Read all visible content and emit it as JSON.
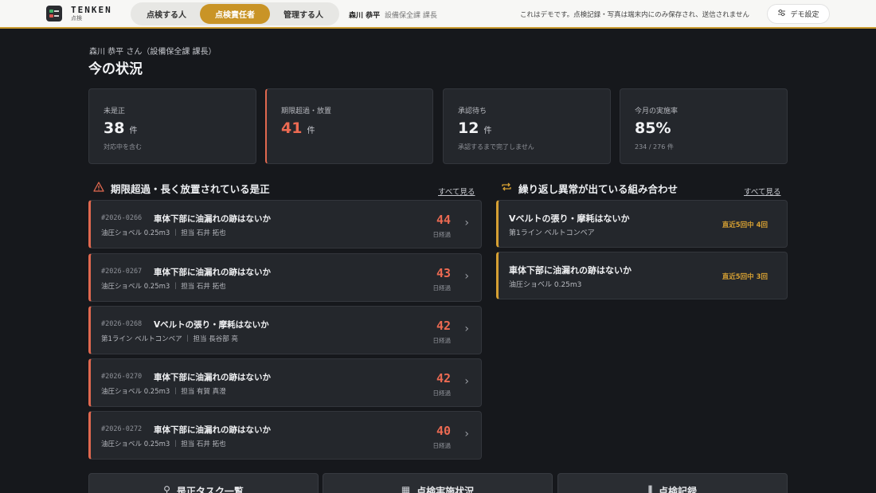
{
  "app": {
    "brand": "TENKEN",
    "brand_sub": "点検"
  },
  "roles": [
    "点検する人",
    "点検責任者",
    "管理する人"
  ],
  "user": {
    "name": "森川 恭平",
    "dept": "設備保全課 課長"
  },
  "demo_notice": "これはデモです。点検記録・写真は端末内にのみ保存され、送信されません",
  "demo_settings_label": "デモ設定",
  "greeting": "森川 恭平 さん（設備保全課 課長）",
  "page_title": "今の状況",
  "stats": [
    {
      "label": "未是正",
      "value": "38",
      "unit": "件",
      "note": "対応中を含む"
    },
    {
      "label": "期限超過・放置",
      "value": "41",
      "unit": "件",
      "note": ""
    },
    {
      "label": "承認待ち",
      "value": "12",
      "unit": "件",
      "note": "承認するまで完了しません"
    },
    {
      "label": "今月の実施率",
      "value": "85%",
      "unit": "",
      "note": "234 / 276 件"
    }
  ],
  "overdue": {
    "title": "期限超過・長く放置されている是正",
    "see_all": "すべて見る",
    "days_label": "日経過",
    "items": [
      {
        "id": "#2026-0266",
        "title": "車体下部に油漏れの跡はないか",
        "meta": "油圧ショベル 0.25m3 ｜ 担当 石井 拓也",
        "days": "44"
      },
      {
        "id": "#2026-0267",
        "title": "車体下部に油漏れの跡はないか",
        "meta": "油圧ショベル 0.25m3 ｜ 担当 石井 拓也",
        "days": "43"
      },
      {
        "id": "#2026-0268",
        "title": "Vベルトの張り・摩耗はないか",
        "meta": "第1ライン ベルトコンベア ｜ 担当 長谷部 亮",
        "days": "42"
      },
      {
        "id": "#2026-0270",
        "title": "車体下部に油漏れの跡はないか",
        "meta": "油圧ショベル 0.25m3 ｜ 担当 有賀 真澄",
        "days": "42"
      },
      {
        "id": "#2026-0272",
        "title": "車体下部に油漏れの跡はないか",
        "meta": "油圧ショベル 0.25m3 ｜ 担当 石井 拓也",
        "days": "40"
      }
    ]
  },
  "repeats": {
    "title": "繰り返し異常が出ている組み合わせ",
    "see_all": "すべて見る",
    "items": [
      {
        "title": "Vベルトの張り・摩耗はないか",
        "sub": "第1ライン ベルトコンベア",
        "count": "直近5回中 4回"
      },
      {
        "title": "車体下部に油漏れの跡はないか",
        "sub": "油圧ショベル 0.25m3",
        "count": "直近5回中 3回"
      }
    ]
  },
  "bottom_buttons": [
    "是正タスク一覧",
    "点検実施状況",
    "点検記録"
  ],
  "icons": {
    "alert": "warning-triangle-icon",
    "repeat": "repeat-arrows-icon",
    "settings": "sliders-icon",
    "chevron": "chevron-right-icon"
  },
  "colors": {
    "accent": "#c99426",
    "danger": "#ec6a52",
    "warning": "#d6a033",
    "background": "#16181c"
  }
}
